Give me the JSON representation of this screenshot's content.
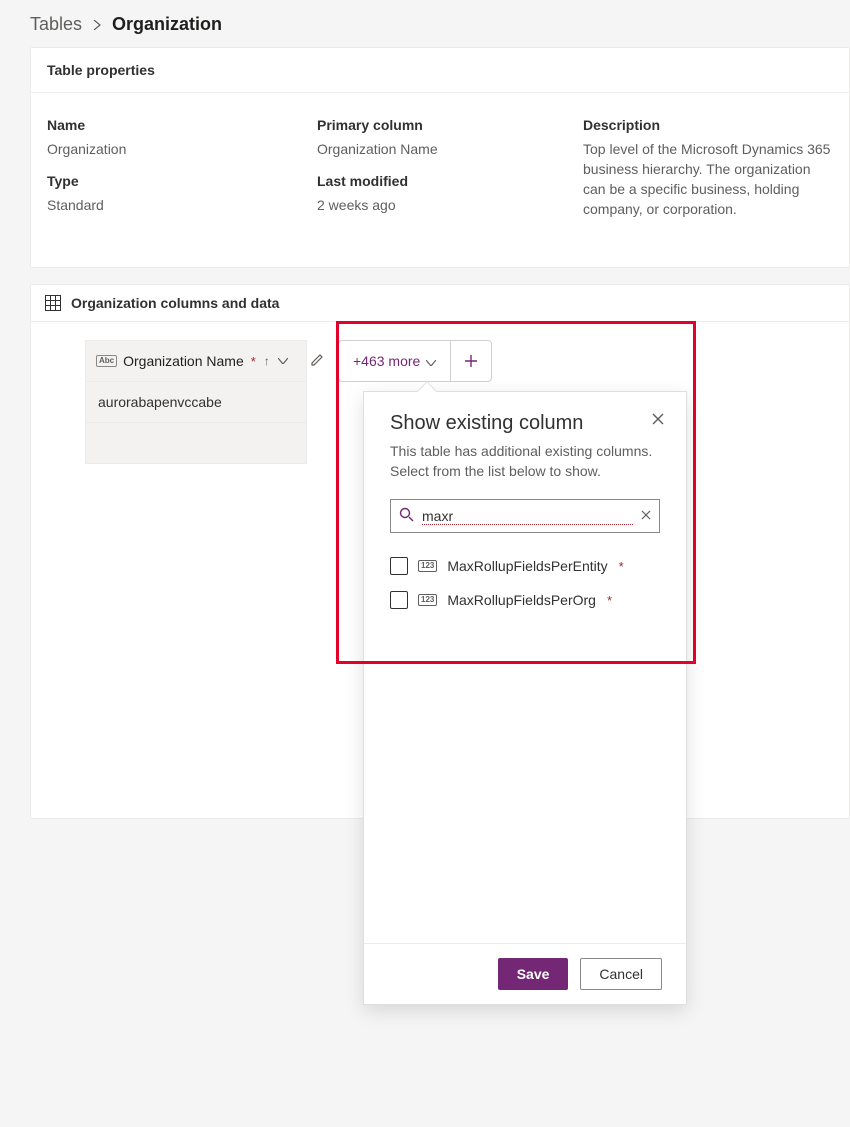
{
  "breadcrumb": {
    "parent": "Tables",
    "current": "Organization"
  },
  "properties": {
    "card_title": "Table properties",
    "name_label": "Name",
    "name_value": "Organization",
    "type_label": "Type",
    "type_value": "Standard",
    "primary_label": "Primary column",
    "primary_value": "Organization Name",
    "modified_label": "Last modified",
    "modified_value": "2 weeks ago",
    "description_label": "Description",
    "description_value": "Top level of the Microsoft Dynamics 365 business hierarchy. The organization can be a specific business, holding company, or corporation."
  },
  "columns_section": {
    "title": "Organization columns and data",
    "column_header": "Organization Name",
    "more_label": "+463 more",
    "rows": [
      "aurorabapenvccabe"
    ]
  },
  "flyout": {
    "title": "Show existing column",
    "description": "This table has additional existing columns. Select from the list below to show.",
    "search_value": "maxr",
    "items": [
      {
        "label": "MaxRollupFieldsPerEntity",
        "required": true
      },
      {
        "label": "MaxRollupFieldsPerOrg",
        "required": true
      }
    ],
    "save_label": "Save",
    "cancel_label": "Cancel"
  }
}
